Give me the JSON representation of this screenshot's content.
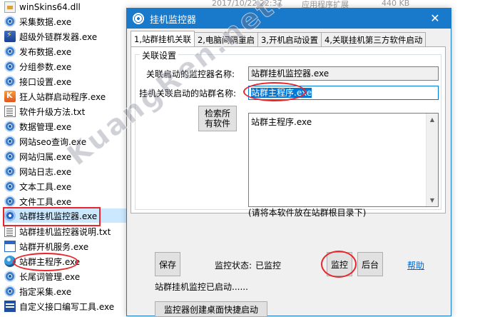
{
  "explorer": {
    "top_meta": {
      "date": "2017/10/22 22:37",
      "type": "应用程序扩展",
      "size": "440 KB"
    },
    "files": [
      {
        "name": "winSkins64.dll",
        "icon": "dll-file-icon"
      },
      {
        "name": "采集数据.exe",
        "icon": "gear-exe-icon"
      },
      {
        "name": "超级外链群发器.exe",
        "icon": "app-exe-icon"
      },
      {
        "name": "发布数据.exe",
        "icon": "gear-exe-icon"
      },
      {
        "name": "分组参数.exe",
        "icon": "gear-exe-icon"
      },
      {
        "name": "接口设置.exe",
        "icon": "gear-exe-icon"
      },
      {
        "name": "狂人站群启动程序.exe",
        "icon": "orange-exe-icon"
      },
      {
        "name": "软件升级方法.txt",
        "icon": "text-file-icon"
      },
      {
        "name": "数据管理.exe",
        "icon": "gear-exe-icon"
      },
      {
        "name": "网站seo查询.exe",
        "icon": "gear-exe-icon"
      },
      {
        "name": "网站归属.exe",
        "icon": "gear-exe-icon"
      },
      {
        "name": "网站日志.exe",
        "icon": "gear-exe-icon"
      },
      {
        "name": "文本工具.exe",
        "icon": "gear-exe-icon"
      },
      {
        "name": "文件工具.exe",
        "icon": "gear-exe-icon"
      },
      {
        "name": "站群挂机监控器.exe",
        "icon": "monitor-exe-icon"
      },
      {
        "name": "站群挂机监控器说明.txt",
        "icon": "text-file-icon"
      },
      {
        "name": "站群开机服务.exe",
        "icon": "window-exe-icon"
      },
      {
        "name": "站群主程序.exe",
        "icon": "ball-exe-icon"
      },
      {
        "name": "长尾词管理.exe",
        "icon": "gear-exe-icon"
      },
      {
        "name": "指定采集.exe",
        "icon": "gear-exe-icon"
      },
      {
        "name": "自定义接口编写工具.exe",
        "icon": "cmd-exe-icon"
      }
    ]
  },
  "dialog": {
    "title": "挂机监控器",
    "close_glyph": "✕",
    "tabs": [
      {
        "label": "1,站群挂机关联",
        "active": true
      },
      {
        "label": "2,电脑间隔重启",
        "active": false
      },
      {
        "label": "3,开机启动设置",
        "active": false
      },
      {
        "label": "4,关联挂机第三方软件启动",
        "active": false
      }
    ],
    "group_title": "关联设置",
    "monitor_name_label": "关联启动的监控器名称:",
    "monitor_name_value": "站群挂机监控器.exe",
    "program_name_label": "挂机关联启动的站群名称:",
    "program_name_value": "站群主程序.exe",
    "search_button": "检索所有软件",
    "list_item": "站群主程序.exe",
    "hint": "(请将本软件放在站群根目录下)",
    "save_button": "保存",
    "status_label": "监控状态:",
    "status_value": "已监控",
    "monitor_button": "监控",
    "background_button": "后台",
    "help_link": "帮助",
    "status_message": "站群挂机监控已启动......",
    "shortcut_button": "监控器创建桌面快捷启动"
  },
  "watermark": "KuangRen.net.cn",
  "colors": {
    "title_bar": "#1979ca",
    "highlight_red": "#e8262b",
    "selection": "#0078d7",
    "link": "#0066cc"
  }
}
